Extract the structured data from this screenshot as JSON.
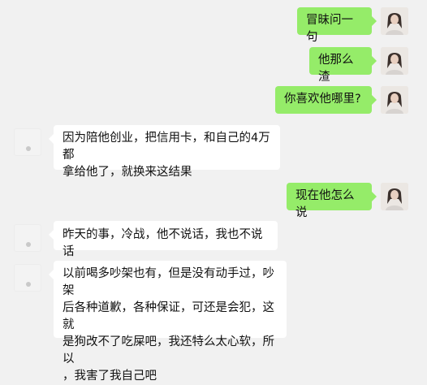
{
  "chat": {
    "messages": [
      {
        "side": "me",
        "text": "冒昧问一句"
      },
      {
        "side": "me",
        "text": "他那么渣"
      },
      {
        "side": "me",
        "text": "你喜欢他哪里?"
      },
      {
        "side": "other",
        "lines": [
          "因为陪他创业，把信用卡，和自己的4万都",
          "拿给他了，就换来这结果"
        ]
      },
      {
        "side": "me",
        "text": "现在他怎么说"
      },
      {
        "side": "other",
        "lines": [
          "昨天的事，冷战，他不说话，我也不说话"
        ]
      },
      {
        "side": "other",
        "lines": [
          "以前喝多吵架也有，但是没有动手过，吵架",
          "后各种道歉，各种保证，可还是会犯，这就",
          "是狗改不了吃屎吧，我还特么太心软，所以",
          "，我害了我自己吧"
        ]
      }
    ]
  },
  "colors": {
    "background": "#f1f1f1",
    "sent_bubble": "#95ec69",
    "received_bubble": "#ffffff"
  },
  "icons": {
    "self_avatar": "avatar-photo-icon",
    "contact_avatar": "avatar-placeholder-icon"
  }
}
